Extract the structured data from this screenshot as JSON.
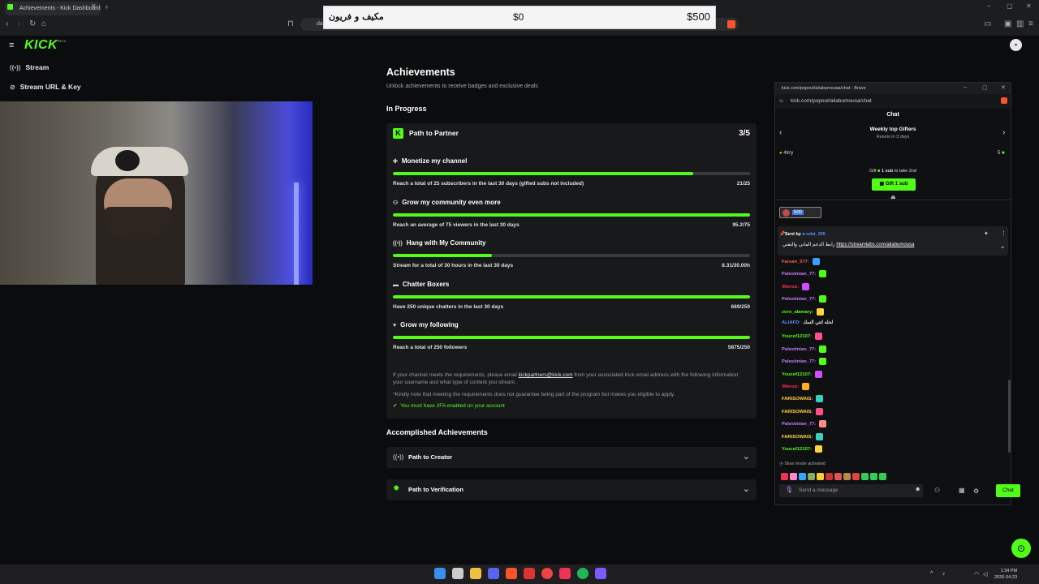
{
  "browser": {
    "tab_title": "Achievements - Kick Dashboard",
    "url_partial": "da"
  },
  "overlay": {
    "name": "مكيف و فريون",
    "current": "$0",
    "goal": "$500"
  },
  "sidebar": {
    "logo": "KICK",
    "logo_beta": "BETA",
    "items": [
      {
        "label": "Stream",
        "icon": "broadcast-icon"
      },
      {
        "label": "Stream URL & Key",
        "icon": "link-icon"
      }
    ]
  },
  "main": {
    "title": "Achievements",
    "subtitle": "Unlock achievements to receive badges and exclusive deals",
    "in_progress_label": "In Progress",
    "partner": {
      "title": "Path to Partner",
      "score": "3/5",
      "milestones": [
        {
          "title": "Monetize my channel",
          "icon": "dollar-icon",
          "desc": "Reach a total of 25 subscribers in the last 30 days (gifted subs not included)",
          "value": "21/25",
          "progress": 0.84
        },
        {
          "title": "Grow my community even more",
          "icon": "users-icon",
          "desc": "Reach an average of 75 viewers in the last 30 days",
          "value": "95.2/75",
          "progress": 1.0
        },
        {
          "title": "Hang with My Community",
          "icon": "broadcast-icon",
          "desc": "Stream for a total of 30 hours in the last 30 days",
          "value": "8.31/30.00h",
          "progress": 0.277
        },
        {
          "title": "Chatter Boxers",
          "icon": "chat-icon",
          "desc": "Have 250 unique chatters in the last 30 days",
          "value": "669/250",
          "progress": 1.0
        },
        {
          "title": "Grow my following",
          "icon": "heart-icon",
          "desc": "Reach a total of 250 followers",
          "value": "5875/250",
          "progress": 1.0
        }
      ],
      "note_pre": "If your channel meets the requirements, please email ",
      "note_email": "kickpartners@kick.com",
      "note_post": " from your associated Kick email address with the following information: your username and what type of content you stream.",
      "note2": "*Kindly note that meeting the requirements does not guarantee being part of the program but makes you eligible to apply.",
      "fa_note": "You must have 2FA enabled on your account"
    },
    "accomplished_label": "Accomplished Achievements",
    "accomplished": [
      {
        "title": "Path to Creator",
        "icon": "broadcast-icon"
      },
      {
        "title": "Path to Verification",
        "icon": "verified-icon"
      }
    ]
  },
  "chat": {
    "window_title": "kick.com/popout/aliabumousa/chat - Brave",
    "url": "kick.com/popout/aliabumousa/chat",
    "header": "Chat",
    "gifters_title": "Weekly top Gifters",
    "gifters_sub": "Resets in 3 days",
    "top_gifter": "4trry",
    "top_gifter_count": "5",
    "gift_line_pre": "Gift",
    "gift_line_bold": "1 sub",
    "gift_line_post": "to take 2nd",
    "gift_button": "Gift 1 sub",
    "badge_value": "500",
    "pinned_sent_by": "Sent by",
    "pinned_user": "odai_305",
    "pinned_text": "رابط الدعم الماني والتقني",
    "pinned_link": "https://streamlabs.com/aliabumousa",
    "messages": [
      {
        "user": "Farsan_577:",
        "color": "#ff5a5a",
        "emote": "#3aa0ff"
      },
      {
        "user": "Palestinian_77:",
        "color": "#c77dff",
        "emote": "#53fc18"
      },
      {
        "user": "!Meroo:",
        "color": "#ff3355",
        "emote": "#d34cff"
      },
      {
        "user": "Palestinian_77:",
        "color": "#c77dff",
        "emote": "#53fc18"
      },
      {
        "user": "zoro_alamary:",
        "color": "#53fc18",
        "emote": "#ffd23f"
      },
      {
        "user": "ALIAFD:",
        "color": "#5a8cff",
        "text": "لحله اتتي السك"
      },
      {
        "user": "Youcef12107:",
        "color": "#53fc18",
        "emote": "#ff4f8b"
      },
      {
        "user": "Palestinian_77:",
        "color": "#c77dff",
        "emote": "#53fc18"
      },
      {
        "user": "Palestinian_77:",
        "color": "#c77dff",
        "emote": "#53fc18"
      },
      {
        "user": "Youcef12107:",
        "color": "#53fc18",
        "emote": "#d34cff"
      },
      {
        "user": "!Meroo:",
        "color": "#ff3355",
        "emote": "#ffb020"
      },
      {
        "user": "FARISOWAIS:",
        "color": "#ffd23f",
        "emote": "#3ad0c0"
      },
      {
        "user": "FARISOWAIS:",
        "color": "#ffd23f",
        "emote": "#ff4f8b"
      },
      {
        "user": "Palestinian_77:",
        "color": "#c77dff",
        "emote": "#ff8a8a"
      },
      {
        "user": "FARISOWAIS:",
        "color": "#ffd23f",
        "emote": "#3ad0c0"
      },
      {
        "user": "Youcef12107:",
        "color": "#53fc18",
        "emote": "#ffd23f"
      }
    ],
    "slow_mode": "Slow mode activated",
    "input_placeholder": "Send a message",
    "chat_button": "Chat"
  },
  "taskbar": {
    "time": "1:34 PM",
    "date": "2026-04-23"
  },
  "colors": {
    "accent": "#53fc18",
    "bg": "#0b0c0d",
    "card": "#18191b"
  }
}
